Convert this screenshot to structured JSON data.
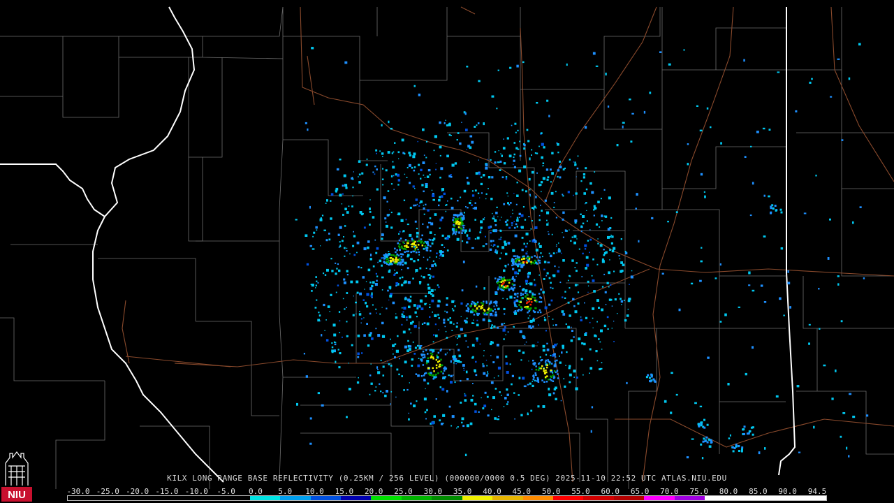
{
  "product": {
    "caption": "KILX LONG RANGE BASE REFLECTIVITY (0.25KM / 256 LEVEL) (000000/0000 0.5 DEG) 2025-11-10 22:52 UTC  ATLAS.NIU.EDU"
  },
  "logo": {
    "text": "NIU",
    "color": "#c8102e"
  },
  "colorbar": {
    "labels": [
      "-30.0",
      "-25.0",
      "-20.0",
      "-15.0",
      "-10.0",
      "-5.0",
      "0.0",
      "5.0",
      "10.0",
      "15.0",
      "20.0",
      "25.0",
      "30.0",
      "35.0",
      "40.0",
      "45.0",
      "50.0",
      "55.0",
      "60.0",
      "65.0",
      "70.0",
      "75.0",
      "80.0",
      "85.0",
      "90.0",
      "94.5"
    ],
    "colors": [
      "#000000",
      "#000000",
      "#000000",
      "#000000",
      "#000000",
      "#000000",
      "#00e4e4",
      "#00a0f0",
      "#0050e0",
      "#0000b0",
      "#00e000",
      "#00b400",
      "#008c00",
      "#f0f000",
      "#e6b400",
      "#ff8c00",
      "#ff0000",
      "#d20000",
      "#b40000",
      "#ff00ff",
      "#a000e0",
      "#ffffff",
      "#ffffff",
      "#ffffff",
      "#ffffff"
    ]
  },
  "map": {
    "county_line_color": "#7a7a7a",
    "state_line_color": "#ffffff",
    "highway_color": "#8b4a2b",
    "radar_colors": [
      "#00c8f0",
      "#1e90ff",
      "#0050e0",
      "#00d800",
      "#00a000",
      "#f0f000",
      "#ffa500",
      "#ff2000"
    ]
  }
}
